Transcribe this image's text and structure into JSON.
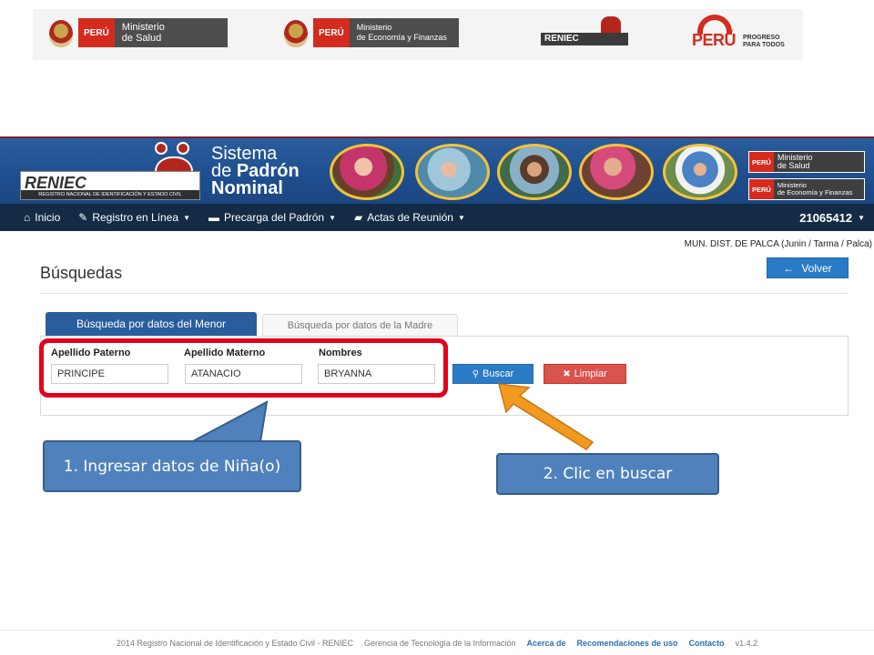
{
  "logos": {
    "minsa_peru": "PERÚ",
    "minsa_line1": "Ministerio",
    "minsa_line2": "de Salud",
    "mef_peru": "PERÚ",
    "mef_line1": "Ministerio",
    "mef_line2": "de Economía y Finanzas",
    "reniec_mini": "RENIEC",
    "progreso_word": "PERÚ",
    "progreso_tag1": "PROGRESO",
    "progreso_tag2": "PARA TODOS"
  },
  "header": {
    "reniec": "RENIEC",
    "reniec_sub": "REGISTRO NACIONAL DE IDENTIFICACIÓN Y ESTADO CIVIL",
    "title_l1": "Sistema",
    "title_l2a": "de",
    "title_l2b": "Padrón",
    "title_l3": "Nominal",
    "badge1_peru": "PERÚ",
    "badge1_l1": "Ministerio",
    "badge1_l2": "de Salud",
    "badge2_peru": "PERÚ",
    "badge2_l1": "Ministerio",
    "badge2_l2": "de Economía y Finanzas"
  },
  "navbar": {
    "items": [
      {
        "label": "Inicio",
        "icon": "home-icon"
      },
      {
        "label": "Registro en Línea",
        "icon": "pencil-icon"
      },
      {
        "label": "Precarga del Padrón",
        "icon": "printer-icon"
      },
      {
        "label": "Actas de Reunión",
        "icon": "folder-icon"
      }
    ],
    "user": "21065412"
  },
  "content": {
    "municipality": "MUN. DIST. DE PALCA (Junin / Tarma / Palca)",
    "title": "Búsquedas",
    "volver": "Volver",
    "tab_active": "Búsqueda por datos del Menor",
    "tab_inactive": "Búsqueda por datos de la Madre",
    "fields": [
      {
        "label": "Apellido Paterno",
        "value": "PRINCIPE"
      },
      {
        "label": "Apellido Materno",
        "value": "ATANACIO"
      },
      {
        "label": "Nombres",
        "value": "BRYANNA"
      }
    ],
    "buscar": "Buscar",
    "limpiar": "Limpiar"
  },
  "callouts": {
    "step1": "1. Ingresar datos de Niña(o)",
    "step2": "2. Clic en buscar"
  },
  "colors": {
    "header_blue": "#1f4f8f",
    "navbar": "#132b45",
    "primary_button": "#2a7bc6",
    "danger_button": "#d9534f",
    "highlight": "#e3001b",
    "callout": "#4f81bd",
    "arrow": "#f29a1f"
  },
  "footer": {
    "copyright": "2014 Registro Nacional de Identificación y Estado Civil - RENIEC",
    "gerencia": "Gerencia de Tecnología de la Información",
    "acerca": "Acerca de",
    "recomendaciones": "Recomendaciones de uso",
    "contacto": "Contacto",
    "version": "v1.4.2"
  }
}
